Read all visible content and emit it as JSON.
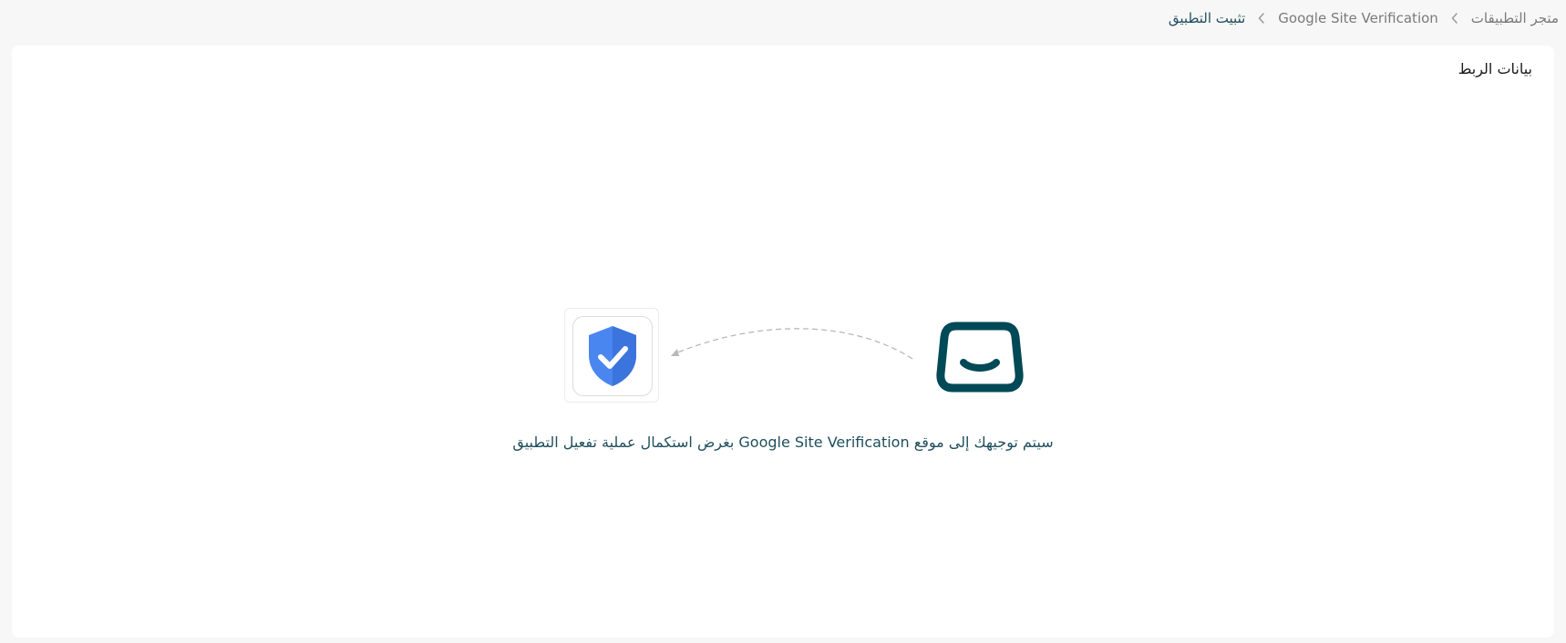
{
  "breadcrumb": {
    "items": [
      {
        "label": "متجر التطبيقات"
      },
      {
        "label": "Google Site Verification"
      }
    ],
    "current": "تثبيت التطبيق"
  },
  "card": {
    "title": "بيانات الربط"
  },
  "flow": {
    "target_app_icon": "shield-check-icon",
    "source_app_icon": "salla-logo-icon",
    "connector": "dashed-arrow"
  },
  "message": "سيتم توجيهك إلى موقع Google Site Verification بغرض استكمال عملية تفعيل التطبيق",
  "colors": {
    "background": "#f7f7f7",
    "card": "#ffffff",
    "brand_dark": "#004956",
    "accent_blue": "#4a86f0",
    "text_teal": "#1f4f5c"
  }
}
